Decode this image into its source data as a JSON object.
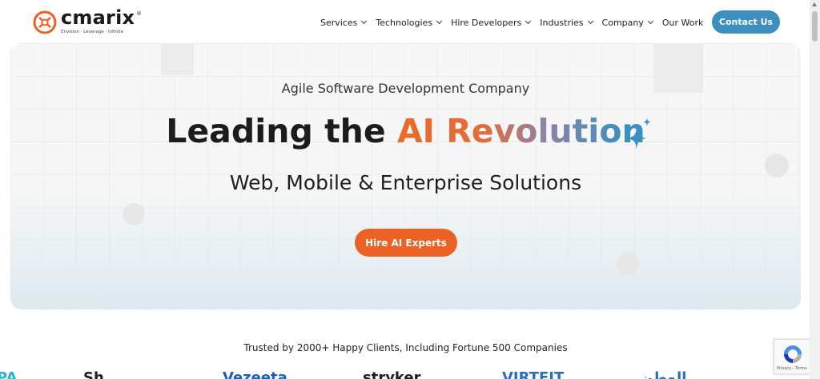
{
  "brand": {
    "name": "cmarix",
    "registered": "®",
    "tagline": "Envision · Leverage · Infinite",
    "colors": {
      "orange": "#ec6224",
      "blue": "#3d8fbf"
    }
  },
  "nav": {
    "items": [
      {
        "label": "Services",
        "has_dropdown": true
      },
      {
        "label": "Technologies",
        "has_dropdown": true
      },
      {
        "label": "Hire Developers",
        "has_dropdown": true
      },
      {
        "label": "Industries",
        "has_dropdown": true
      },
      {
        "label": "Company",
        "has_dropdown": true
      },
      {
        "label": "Our Work",
        "has_dropdown": false
      }
    ],
    "cta": "Contact Us"
  },
  "hero": {
    "eyebrow": "Agile Software Development Company",
    "headline_prefix": "Leading the ",
    "headline_highlight": "AI Revolution",
    "subline": "Web, Mobile & Enterprise Solutions",
    "cta": "Hire AI Experts"
  },
  "trusted": {
    "text": "Trusted by 2000+ Happy Clients, Including Fortune 500 Companies",
    "logos": [
      {
        "text": "PA",
        "color": "#2bb3c9"
      },
      {
        "text": "Sh",
        "color": "#1f1f1f"
      },
      {
        "text": "Vezeeta",
        "color": "#1f5fb3"
      },
      {
        "text": "stryker",
        "color": "#1f1f1f"
      },
      {
        "text": "VIRTEIT",
        "color": "#2c6fb6"
      },
      {
        "text": "الوطن",
        "color": "#2c6fb6"
      }
    ]
  },
  "recaptcha": {
    "text": "Privacy - Terms"
  }
}
